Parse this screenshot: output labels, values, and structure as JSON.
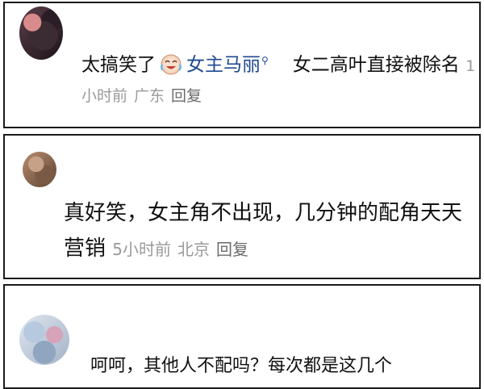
{
  "comments": [
    {
      "prefix": "太搞笑了",
      "emoji_icon": "laugh-cry-emoji-icon",
      "mention": "女主马丽",
      "body_after": "女二高叶直接被除名",
      "time": "1小时前",
      "location": "广东",
      "reply_label": "回复"
    },
    {
      "body": "真好笑，女主角不出现，几分钟的配角天天营销",
      "time": "5小时前",
      "location": "北京",
      "reply_label": "回复"
    },
    {
      "body": "呵呵，其他人不配吗？每次都是这几个"
    }
  ],
  "colors": {
    "mention": "#1f4a8f",
    "meta": "#9a9a9a",
    "border": "#1a1a1a"
  }
}
